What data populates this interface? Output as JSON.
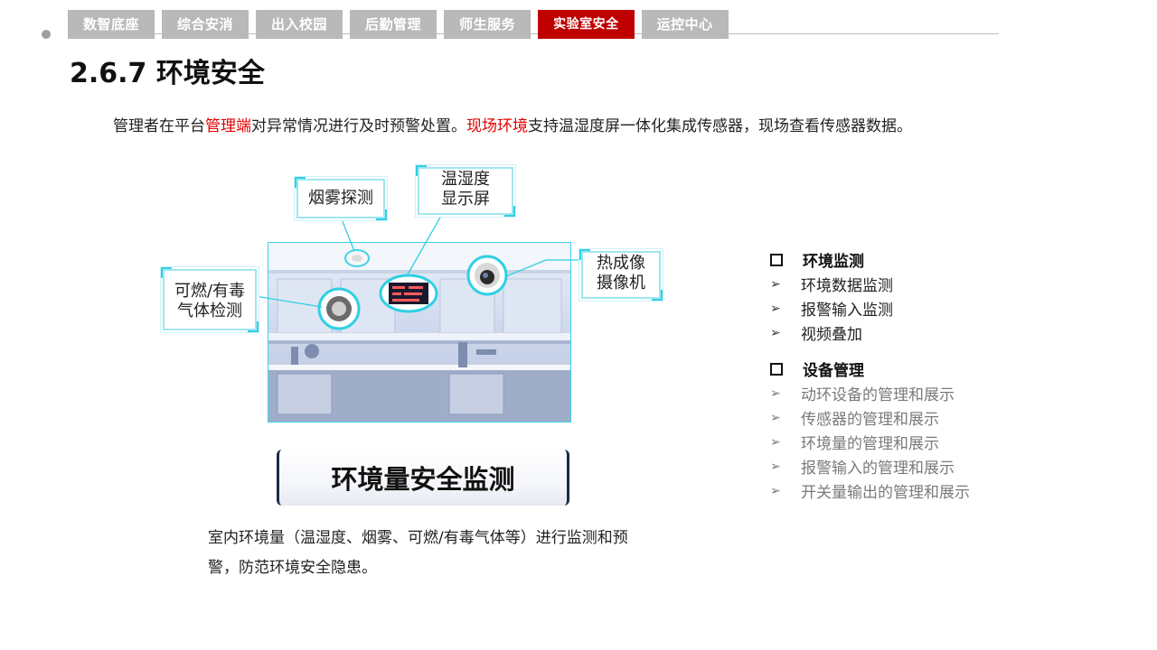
{
  "nav": {
    "tabs": [
      {
        "label": "数智底座",
        "active": false
      },
      {
        "label": "综合安消",
        "active": false
      },
      {
        "label": "出入校园",
        "active": false
      },
      {
        "label": "后勤管理",
        "active": false
      },
      {
        "label": "师生服务",
        "active": false
      },
      {
        "label": "实验室安全",
        "active": true
      },
      {
        "label": "运控中心",
        "active": false
      }
    ]
  },
  "page": {
    "title": "2.6.7 环境安全",
    "intro_1": "管理者在平台",
    "intro_red_1": "管理端",
    "intro_2": "对异常情况进行及时预警处置。",
    "intro_red_2": "现场环境",
    "intro_3": "支持温湿度屏一体化集成传感器，现场查看传感器数据。"
  },
  "diagram": {
    "callout_smoke": "烟雾探测",
    "callout_display_1": "温湿度",
    "callout_display_2": "显示屏",
    "callout_thermal_1": "热成像",
    "callout_thermal_2": "摄像机",
    "callout_gas_1": "可燃/有毒",
    "callout_gas_2": "气体检测",
    "banner": "环境量安全监测",
    "description": "室内环境量（温湿度、烟雾、可燃/有毒气体等）进行监测和预警，防范环境安全隐患。"
  },
  "features": {
    "group1_title": "环境监测",
    "group1_items": [
      "环境数据监测",
      "报警输入监测",
      "视频叠加"
    ],
    "group2_title": "设备管理",
    "group2_items": [
      "动环设备的管理和展示",
      "传感器的管理和展示",
      "环境量的管理和展示",
      "报警输入的管理和展示",
      "开关量输出的管理和展示"
    ]
  },
  "colors": {
    "accent_red": "#c00000",
    "tab_gray": "#b9b9b9",
    "callout_cyan": "#2fd0e4"
  }
}
